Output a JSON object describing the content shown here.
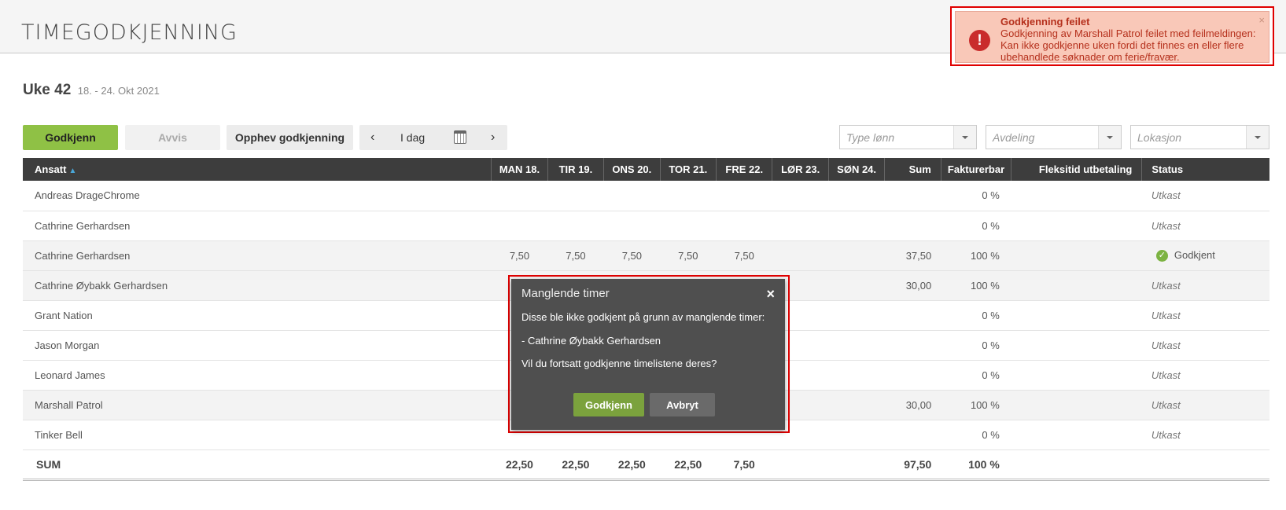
{
  "app": {
    "title": "TIMEGODKJENNING"
  },
  "week": {
    "label": "Uke 42",
    "range": "18. - 24. Okt 2021"
  },
  "toolbar": {
    "approve_label": "Godkjenn",
    "reject_label": "Avvis",
    "revoke_label": "Opphev godkjenning",
    "today_label": "I dag",
    "prev_glyph": "‹",
    "next_glyph": "›"
  },
  "filters": {
    "pay_type_placeholder": "Type lønn",
    "department_placeholder": "Avdeling",
    "location_placeholder": "Lokasjon"
  },
  "table": {
    "headers": {
      "employee": "Ansatt",
      "sort_glyph": "▲",
      "mon": "MAN 18.",
      "tue": "TIR 19.",
      "wed": "ONS 20.",
      "thu": "TOR 21.",
      "fri": "FRE 22.",
      "sat": "LØR 23.",
      "sun": "SØN 24.",
      "sum": "Sum",
      "billable": "Fakturerbar",
      "flex": "Fleksitid utbetaling",
      "status": "Status"
    },
    "rows": [
      {
        "name": "Andreas DrageChrome",
        "mon": "",
        "tue": "",
        "wed": "",
        "thu": "",
        "fri": "",
        "sat": "",
        "sun": "",
        "sum": "",
        "billable": "0 %",
        "flex": "",
        "status": "Utkast"
      },
      {
        "name": "Cathrine Gerhardsen",
        "mon": "",
        "tue": "",
        "wed": "",
        "thu": "",
        "fri": "",
        "sat": "",
        "sun": "",
        "sum": "",
        "billable": "0 %",
        "flex": "",
        "status": "Utkast"
      },
      {
        "name": "Cathrine Gerhardsen",
        "mon": "7,50",
        "tue": "7,50",
        "wed": "7,50",
        "thu": "7,50",
        "fri": "7,50",
        "sat": "",
        "sun": "",
        "sum": "37,50",
        "billable": "100 %",
        "flex": "",
        "status": "Godkjent"
      },
      {
        "name": "Cathrine Øybakk Gerhardsen",
        "mon": "",
        "tue": "",
        "wed": "",
        "thu": "",
        "fri": "",
        "sat": "",
        "sun": "",
        "sum": "30,00",
        "billable": "100 %",
        "flex": "",
        "status": "Utkast"
      },
      {
        "name": "Grant Nation",
        "mon": "",
        "tue": "",
        "wed": "",
        "thu": "",
        "fri": "",
        "sat": "",
        "sun": "",
        "sum": "",
        "billable": "0 %",
        "flex": "",
        "status": "Utkast"
      },
      {
        "name": "Jason Morgan",
        "mon": "",
        "tue": "",
        "wed": "",
        "thu": "",
        "fri": "",
        "sat": "",
        "sun": "",
        "sum": "",
        "billable": "0 %",
        "flex": "",
        "status": "Utkast"
      },
      {
        "name": "Leonard James",
        "mon": "",
        "tue": "",
        "wed": "",
        "thu": "",
        "fri": "",
        "sat": "",
        "sun": "",
        "sum": "",
        "billable": "0 %",
        "flex": "",
        "status": "Utkast"
      },
      {
        "name": "Marshall Patrol",
        "mon": "",
        "tue": "",
        "wed": "",
        "thu": "",
        "fri": "",
        "sat": "",
        "sun": "",
        "sum": "30,00",
        "billable": "100 %",
        "flex": "",
        "status": "Utkast"
      },
      {
        "name": "Tinker Bell",
        "mon": "",
        "tue": "",
        "wed": "",
        "thu": "",
        "fri": "",
        "sat": "",
        "sun": "",
        "sum": "",
        "billable": "0 %",
        "flex": "",
        "status": "Utkast"
      }
    ],
    "totals": {
      "label": "SUM",
      "mon": "22,50",
      "tue": "22,50",
      "wed": "22,50",
      "thu": "22,50",
      "fri": "7,50",
      "sat": "",
      "sun": "",
      "sum": "97,50",
      "billable": "100 %",
      "flex": "",
      "status": ""
    }
  },
  "toast": {
    "title": "Godkjenning feilet",
    "message": "Godkjenning av Marshall Patrol feilet med feilmeldingen: Kan ikke godkjenne uken fordi det finnes en eller flere ubehandlede søknader om ferie/fravær.",
    "icon_glyph": "!",
    "close_glyph": "×",
    "background_color": "#f9c8b8",
    "text_color": "#b5301c"
  },
  "modal": {
    "title": "Manglende timer",
    "close_glyph": "×",
    "line1": "Disse ble ikke godkjent på grunn av manglende timer:",
    "line2": "- Cathrine Øybakk Gerhardsen",
    "line3": "Vil du fortsatt godkjenne timelistene deres?",
    "confirm_label": "Godkjenn",
    "cancel_label": "Avbryt"
  },
  "colors": {
    "accent_green": "#8fc145",
    "header_dark": "#3d3d3d",
    "link_blue": "#2a8fc4",
    "highlight_red": "#e00000"
  },
  "icons": {
    "calendar": "calendar-icon",
    "approved_check": "check-circle-icon",
    "error": "error-circle-icon"
  }
}
